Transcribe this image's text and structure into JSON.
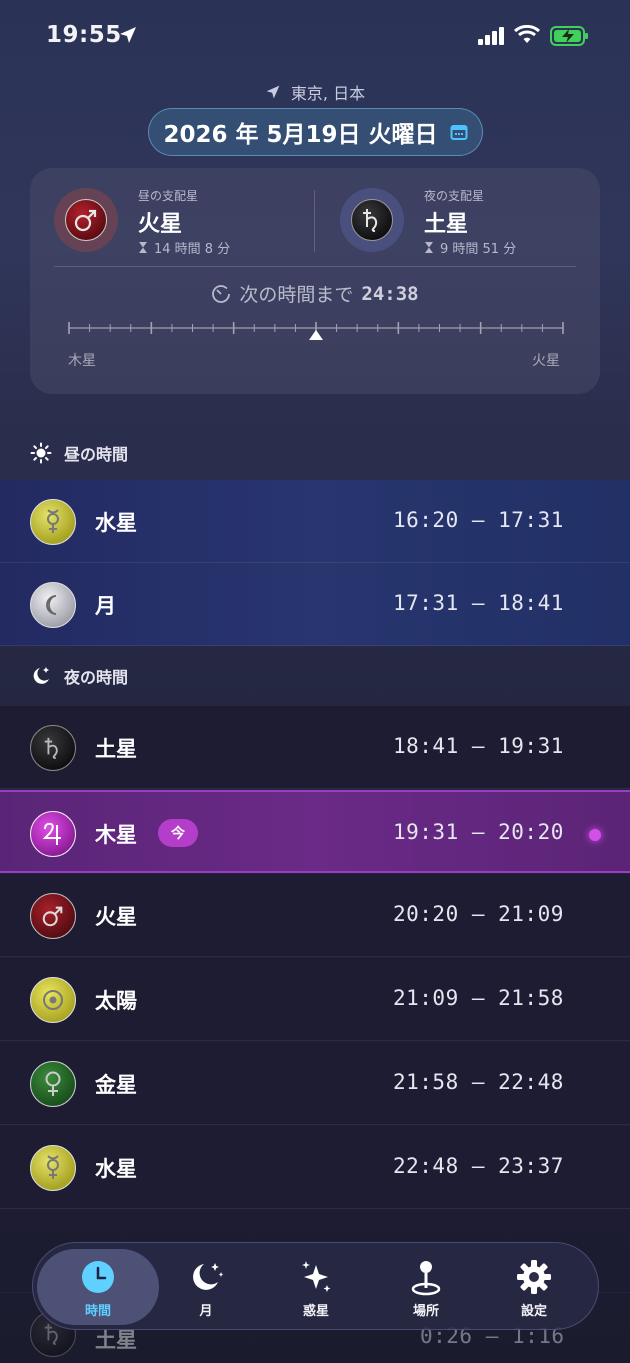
{
  "status_bar": {
    "time": "19:55"
  },
  "header": {
    "location": "東京, 日本",
    "date": "2026 年 5月19日 火曜日"
  },
  "rulers": {
    "day": {
      "label": "昼の支配星",
      "name": "火星",
      "duration": "14 時間 8 分",
      "icon": "mars-symbol"
    },
    "night": {
      "label": "夜の支配星",
      "name": "土星",
      "duration": "9 時間 51 分",
      "icon": "saturn-symbol"
    },
    "countdown_label": "次の時間まで",
    "countdown_value": "24:38",
    "timeline": {
      "start_label": "木星",
      "end_label": "火星",
      "progress": 0.5
    }
  },
  "day_section": {
    "title": "昼の時間",
    "rows": [
      {
        "planet": "水星",
        "range": "16:20 – 17:31",
        "icon": "mercury-symbol",
        "color": "#c9c73c"
      },
      {
        "planet": "月",
        "range": "17:31 – 18:41",
        "icon": "moon-symbol",
        "color": "#c8c9d2"
      }
    ]
  },
  "night_section": {
    "title": "夜の時間",
    "rows": [
      {
        "planet": "土星",
        "range": "18:41 – 19:31",
        "icon": "saturn-symbol",
        "color": "#222226"
      },
      {
        "planet": "木星",
        "range": "19:31 – 20:20",
        "icon": "jupiter-symbol",
        "color": "#c23acb",
        "badge": "今",
        "current": true
      },
      {
        "planet": "火星",
        "range": "20:20 – 21:09",
        "icon": "mars-symbol",
        "color": "#86161e"
      },
      {
        "planet": "太陽",
        "range": "21:09 – 21:58",
        "icon": "sun-symbol",
        "color": "#c9c73c"
      },
      {
        "planet": "金星",
        "range": "21:58 – 22:48",
        "icon": "venus-symbol",
        "color": "#2e6e2e"
      },
      {
        "planet": "水星",
        "range": "22:48 – 23:37",
        "icon": "mercury-symbol",
        "color": "#c9c73c"
      },
      {
        "planet": "土星",
        "range": "0:26 – 1:16",
        "icon": "saturn-symbol",
        "color": "#222226"
      }
    ]
  },
  "tabs": [
    {
      "label": "時間",
      "icon": "clock-icon",
      "active": true
    },
    {
      "label": "月",
      "icon": "moon-stars-icon"
    },
    {
      "label": "惑星",
      "icon": "sparkles-icon"
    },
    {
      "label": "場所",
      "icon": "map-pin-icon"
    },
    {
      "label": "設定",
      "icon": "gear-icon"
    }
  ],
  "colors": {
    "accent_tab": "#5fd0ff",
    "current_badge": "#b43ec9"
  }
}
